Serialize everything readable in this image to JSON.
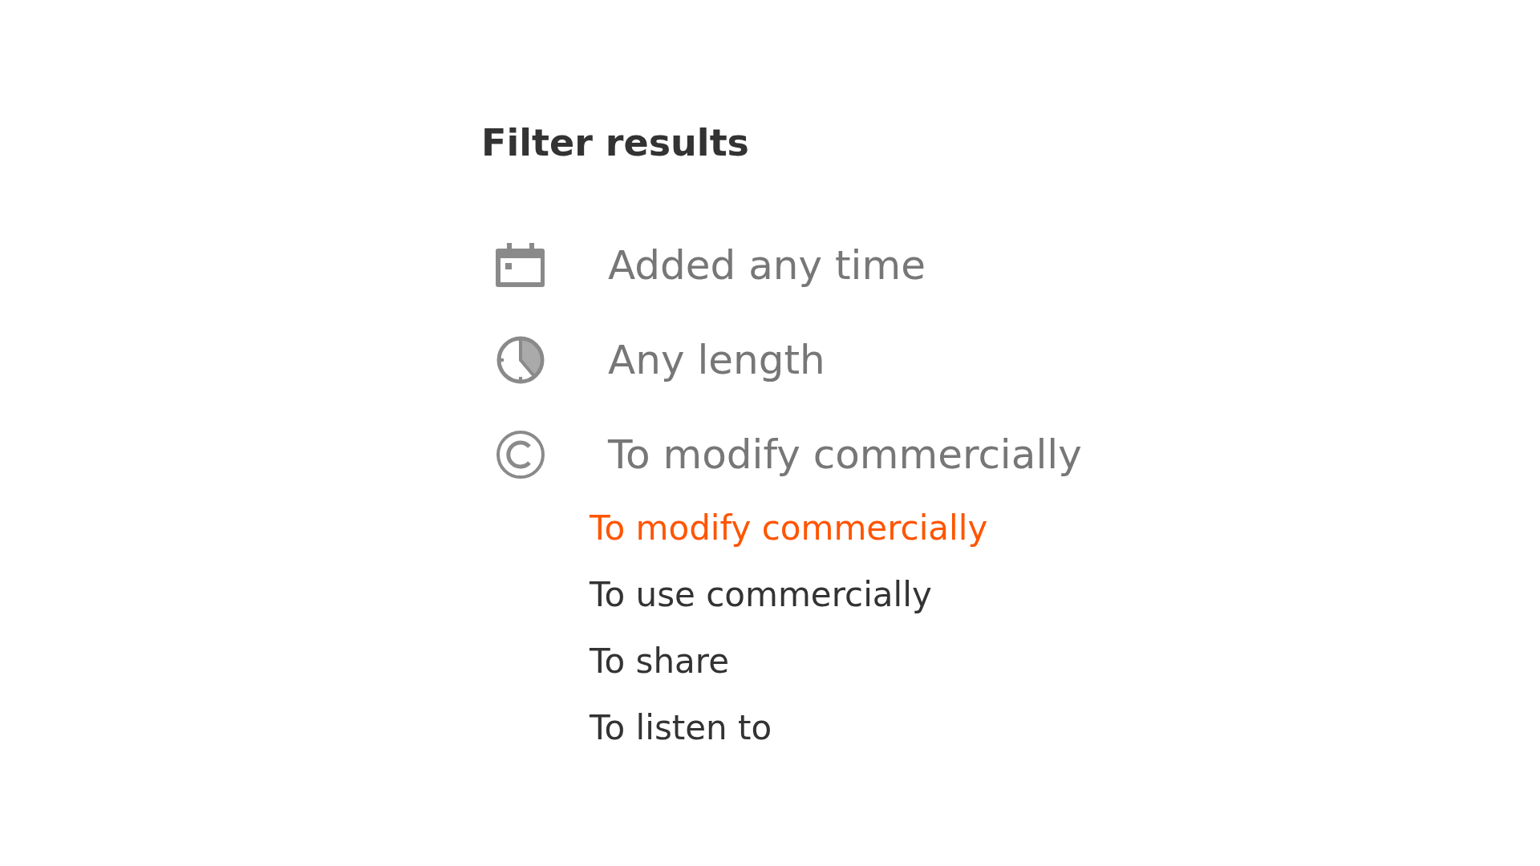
{
  "title": "Filter results",
  "filters": [
    {
      "kind": "date",
      "label": "Added any time"
    },
    {
      "kind": "length",
      "label": "Any length"
    },
    {
      "kind": "license",
      "label": "To modify commercially",
      "options": [
        {
          "label": "To modify commercially",
          "selected": true
        },
        {
          "label": "To use commercially",
          "selected": false
        },
        {
          "label": "To share",
          "selected": false
        },
        {
          "label": "To listen to",
          "selected": false
        }
      ]
    }
  ]
}
